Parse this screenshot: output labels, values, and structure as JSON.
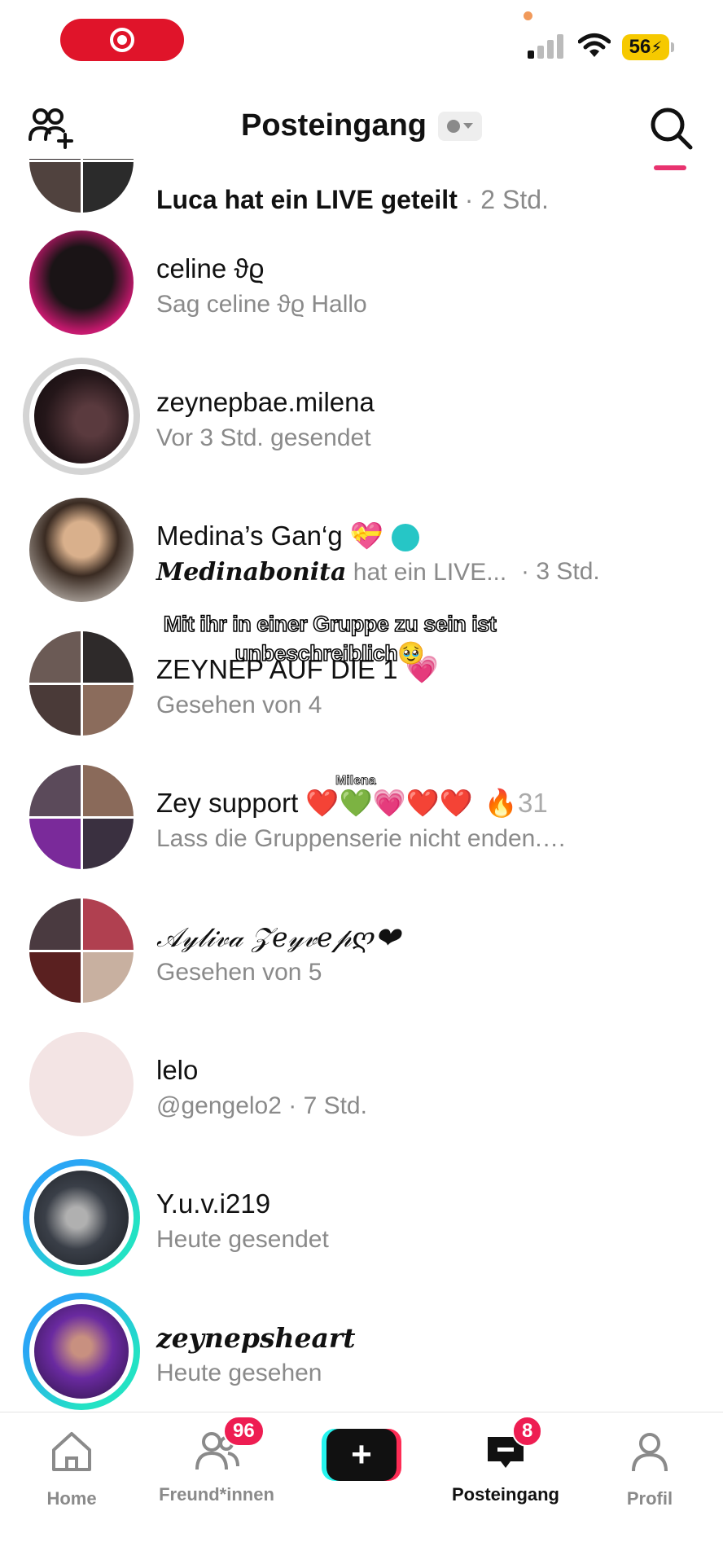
{
  "status_bar": {
    "battery": "56"
  },
  "header": {
    "title": "Posteingang"
  },
  "conversations": [
    {
      "name": "Luca hat ein LIVE geteilt",
      "time": " · 2 Std."
    },
    {
      "name": "celine ϑϱ",
      "preview": "Sag celine ϑϱ Hallo"
    },
    {
      "name": "zeynepbae.milena",
      "preview": "Vor 3 Std. gesendet"
    },
    {
      "name": "Medina’s Gan‘g 💝",
      "preview_name": "𝑴𝒆𝒅𝒊𝒏𝒂𝒃𝒐𝒏𝒊𝒕𝒂",
      "preview": " hat ein LIVE...",
      "time": "· 3 Std."
    },
    {
      "name": "ZEYNEP AUF DIE 1 💗",
      "preview": "Gesehen von 4"
    },
    {
      "name": "Zey support ❤️💚💗❤️❤️",
      "streak": "31",
      "preview": "Lass die Gruppenserie nicht enden.…"
    },
    {
      "name": "𝒜𝓎𝓁𝒾𝓋𝒶 𝒵𝑒𝓎𝓋𝑒𝓅ღ❤",
      "preview": "Gesehen von 5"
    },
    {
      "name": "lelo",
      "preview": "@gengelo2 · 7 Std."
    },
    {
      "name": "Y.u.v.i219",
      "preview": "Heute gesendet"
    },
    {
      "name": "𝒛𝒆𝒚𝒏𝒆𝒑𝒔𝒉𝒆𝒂𝒓𝒕",
      "preview": "Heute gesehen"
    }
  ],
  "overlay": {
    "caption": "Mit ihr in einer Gruppe zu sein ist unbeschreiblich🥹",
    "tag": "Milena"
  },
  "bottom_nav": {
    "home": "Home",
    "friends": "Freund*innen",
    "friends_badge": "96",
    "create": "+",
    "inbox": "Posteingang",
    "inbox_badge": "8",
    "profile": "Profil"
  },
  "colors": {
    "accent": "#fe2c55",
    "cyan": "#25f4ee",
    "record": "#e0142a",
    "battery": "#f6c900"
  },
  "icons": [
    "record-icon",
    "signal-icon",
    "wifi-icon",
    "battery-icon",
    "add-friend-icon",
    "search-icon",
    "home-icon",
    "friends-icon",
    "plus-icon",
    "inbox-icon",
    "profile-icon",
    "flame-icon"
  ]
}
